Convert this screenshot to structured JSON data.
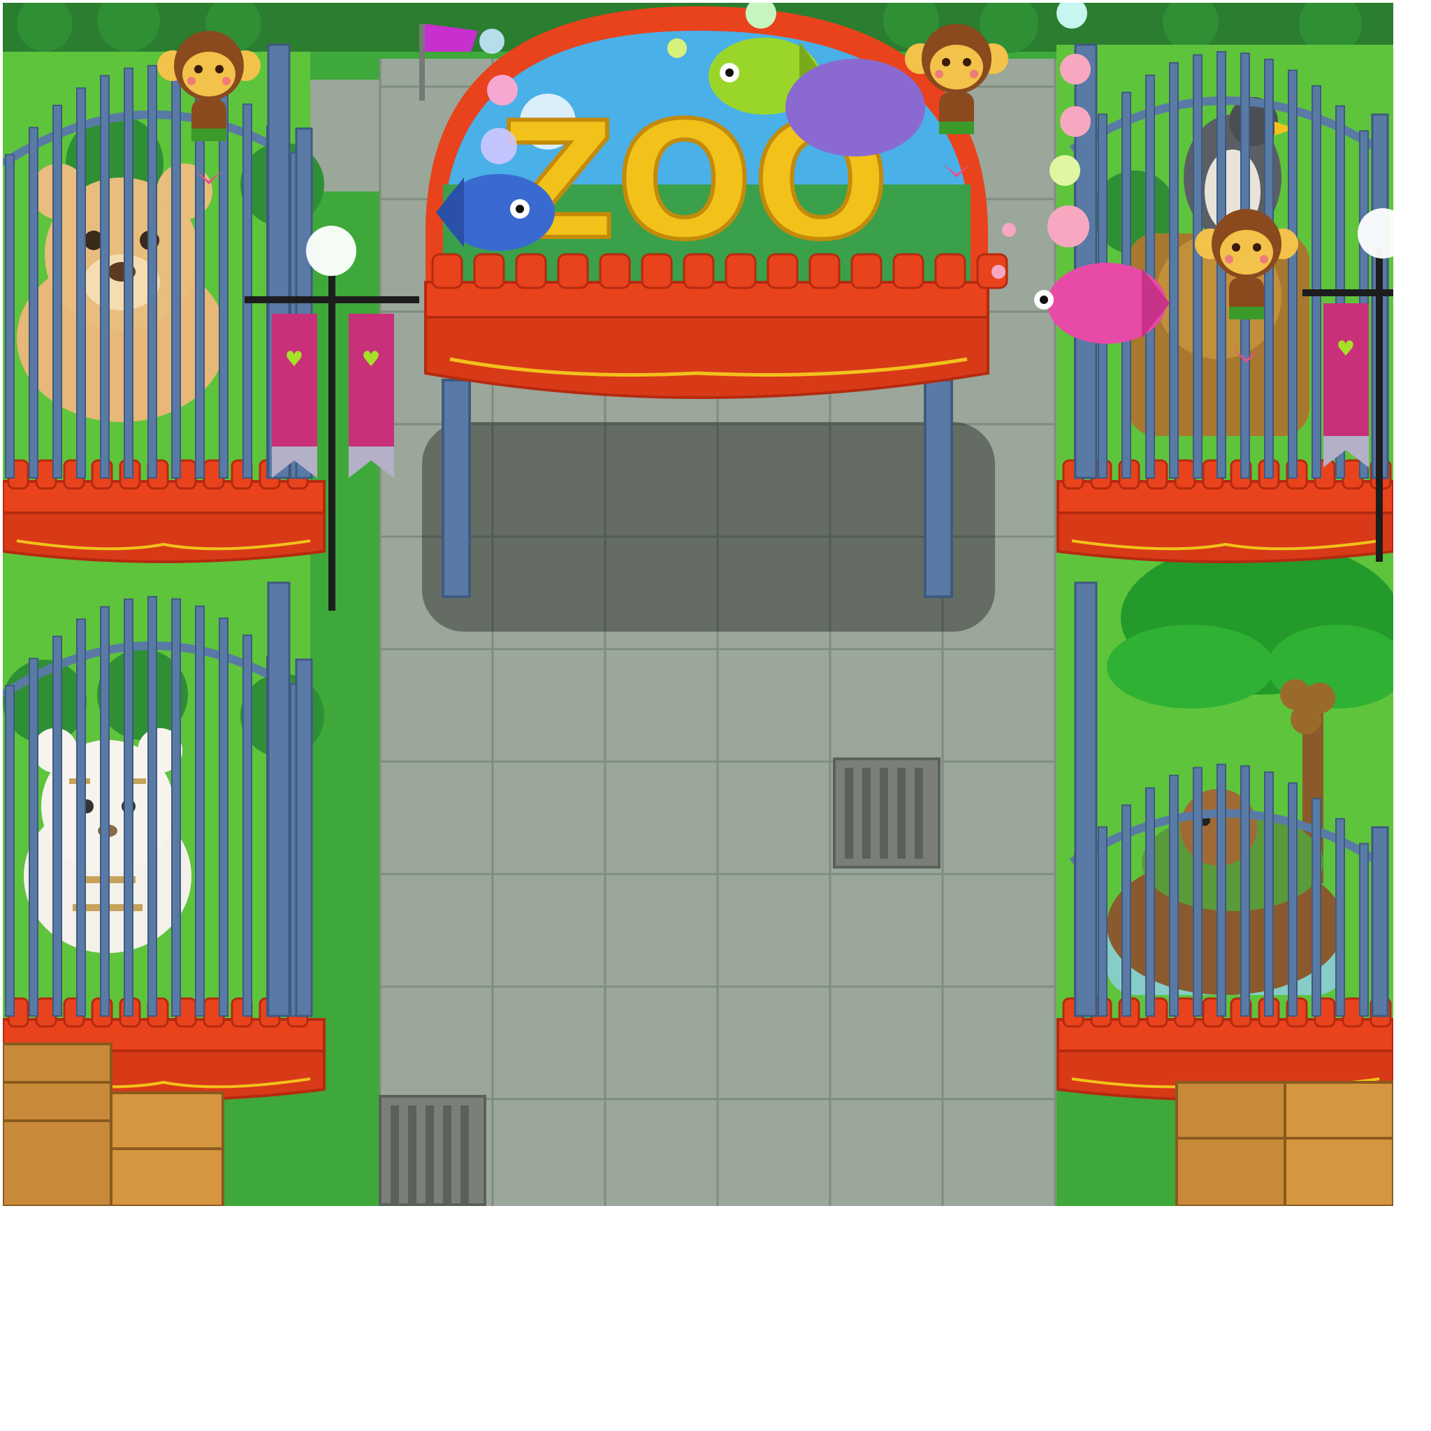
{
  "scene": {
    "type": "pixel-art zoo entrance",
    "sign_text": "ZOO",
    "colors": {
      "grass": "#3fa83a",
      "grass_dark": "#2e8a2c",
      "path": "#9aa79a",
      "path_line": "#7f8c80",
      "tree": "#2f8f35",
      "cage_bar": "#5a7aa6",
      "cage_bar_dark": "#3f5a80",
      "red_base": "#e8431c",
      "red_dark": "#b52a10",
      "gold": "#f2c21b",
      "banner": "#c8307a",
      "crate": "#c88a3a"
    },
    "sign": {
      "animals": [
        "fish-blue",
        "fish-green",
        "fish-pink",
        "whale"
      ]
    },
    "enclosures": [
      {
        "position": "top-left",
        "animal": "bear"
      },
      {
        "position": "bottom-left",
        "animal": "white-tiger"
      },
      {
        "position": "top-right",
        "animal": "falcon-and-lion"
      },
      {
        "position": "bottom-right",
        "animal": "tortoise"
      }
    ],
    "decorations": [
      "monkey",
      "monkey",
      "monkey",
      "street-lamp",
      "street-lamp",
      "banner",
      "banner",
      "banner",
      "crate-stack",
      "crate-stack",
      "drain-grate",
      "drain-grate",
      "palm-tree"
    ]
  }
}
